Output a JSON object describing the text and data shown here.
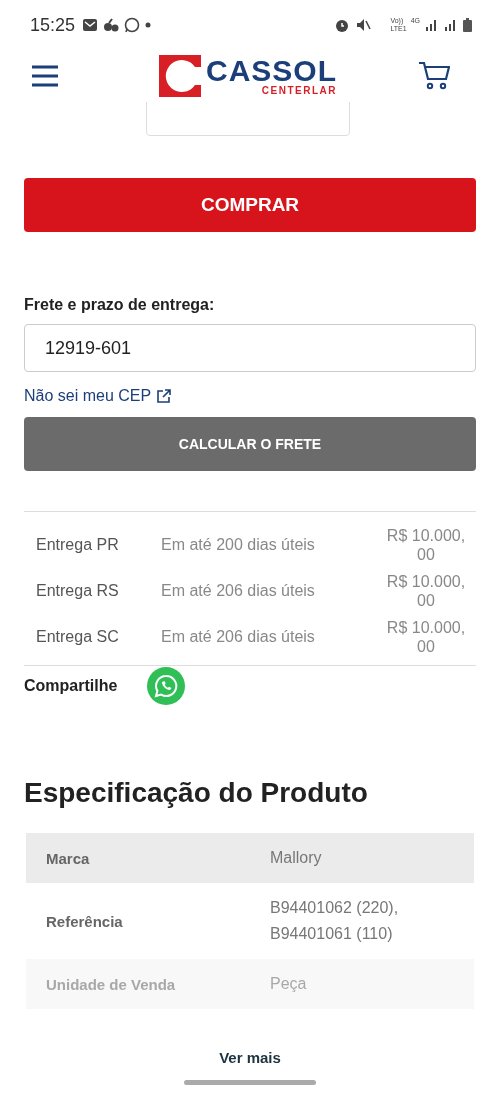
{
  "status_bar": {
    "time": "15:25",
    "network": [
      "Vo))",
      "LTE1",
      "4G"
    ]
  },
  "header": {
    "logo": {
      "name": "CASSOL",
      "tagline": "CENTERLAR"
    }
  },
  "buy_button": "COMPRAR",
  "shipping": {
    "label": "Frete e prazo de entrega:",
    "cep": "12919-601",
    "help_link": "Não sei meu CEP",
    "calc_button": "CALCULAR O FRETE",
    "options": [
      {
        "region": "Entrega PR",
        "term": "Em até 200 dias úteis",
        "price": "R$ 10.000,\n00"
      },
      {
        "region": "Entrega RS",
        "term": "Em até 206 dias úteis",
        "price": "R$ 10.000,\n00"
      },
      {
        "region": "Entrega SC",
        "term": "Em até 206 dias úteis",
        "price": "R$ 10.000,\n00"
      }
    ]
  },
  "share": {
    "label": "Compartilhe"
  },
  "specs": {
    "title": "Especificação do Produto",
    "rows": [
      {
        "name": "Marca",
        "value": "Mallory",
        "faded": false
      },
      {
        "name": "Referência",
        "value": "B94401062 (220),\nB94401061 (110)",
        "faded": false
      },
      {
        "name": "Unidade de Venda",
        "value": "Peça",
        "faded": true
      }
    ],
    "more_link": "Ver mais"
  }
}
